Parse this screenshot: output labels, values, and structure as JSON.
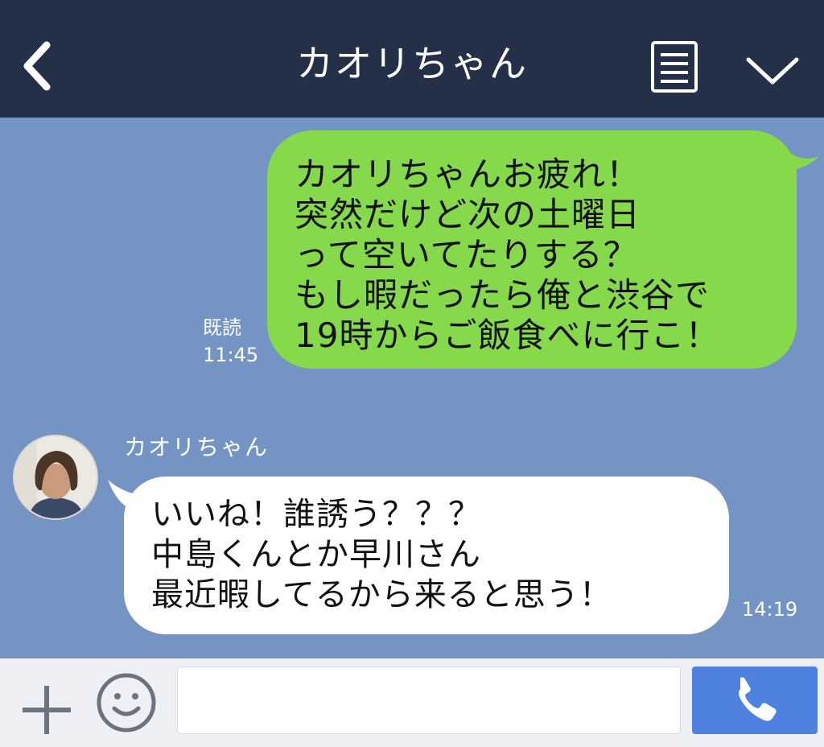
{
  "header": {
    "title": "カオリちゃん",
    "back_icon": "chevron-left-icon",
    "menu_icon": "notes-icon",
    "more_icon": "chevron-down-icon"
  },
  "messages": [
    {
      "direction": "outgoing",
      "text": "カオリちゃんお疲れ！\n突然だけど次の土曜日\nって空いてたりする？\nもし暇だったら俺と渋谷で\n19時からご飯食べに行こ！",
      "read_label": "既読",
      "time": "11:45",
      "bubble_color": "#86d94a"
    },
    {
      "direction": "incoming",
      "sender": "カオリちゃん",
      "text": "いいね！誰誘う？？？\n中島くんとか早川さん\n最近暇してるから来ると思う！",
      "time": "14:19",
      "bubble_color": "#ffffff"
    }
  ],
  "input_bar": {
    "plus_icon": "plus-icon",
    "emoji_icon": "smiley-icon",
    "input_value": "",
    "call_icon": "phone-icon"
  },
  "colors": {
    "header_bg": "#243048",
    "chat_bg": "#7494c4",
    "call_button": "#4f82e0"
  }
}
